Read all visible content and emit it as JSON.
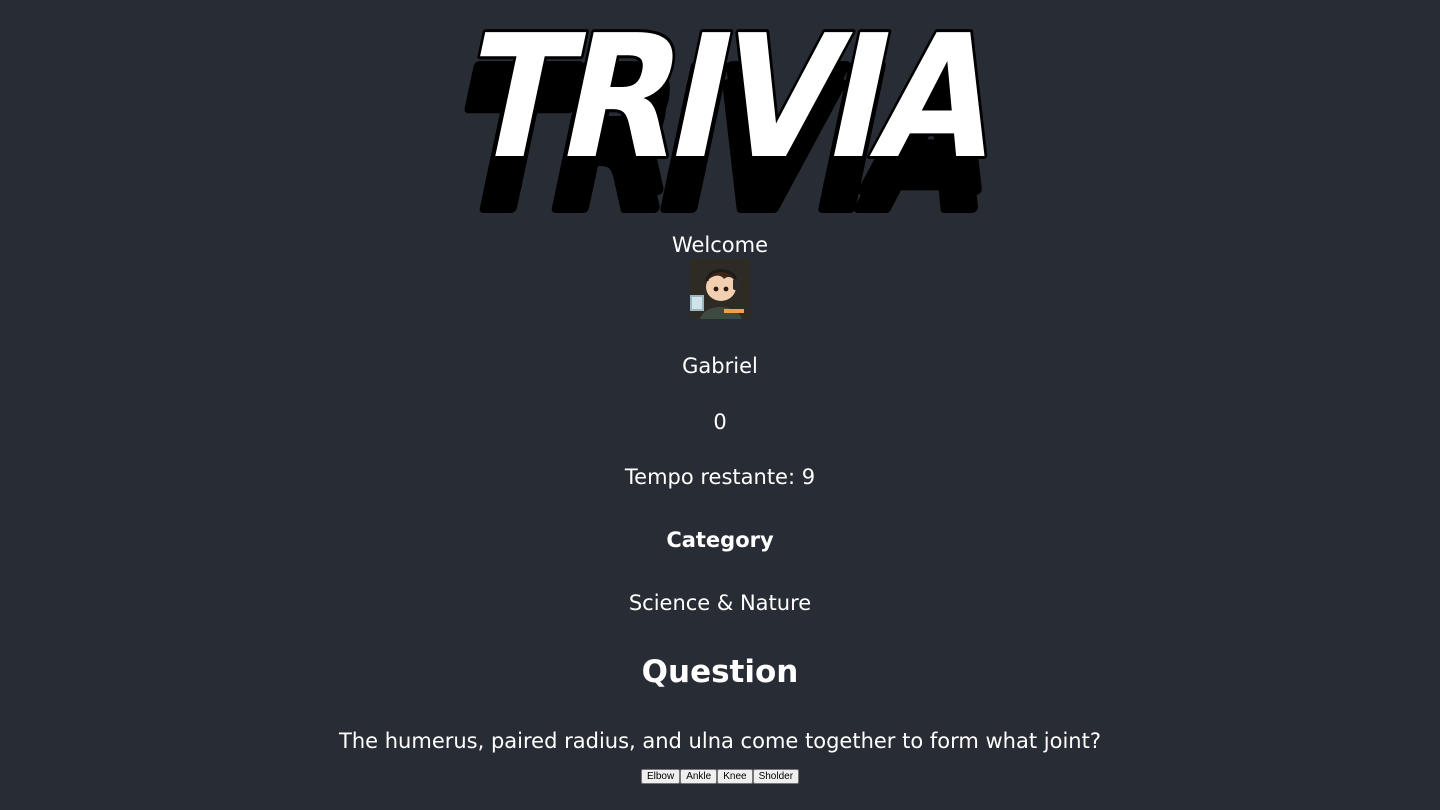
{
  "logo": {
    "text": "TRIVIA"
  },
  "welcome": "Welcome",
  "user": {
    "name": "Gabriel",
    "score": "0",
    "avatar_icon": "anime-boy-headphones-avatar"
  },
  "timer": "Tempo restante: 9",
  "category_heading": "Category",
  "category": "Science & Nature",
  "question_heading": "Question",
  "question": "The humerus, paired radius, and ulna come together to form what joint?",
  "answers": [
    "Elbow",
    "Ankle",
    "Knee",
    "Sholder"
  ]
}
